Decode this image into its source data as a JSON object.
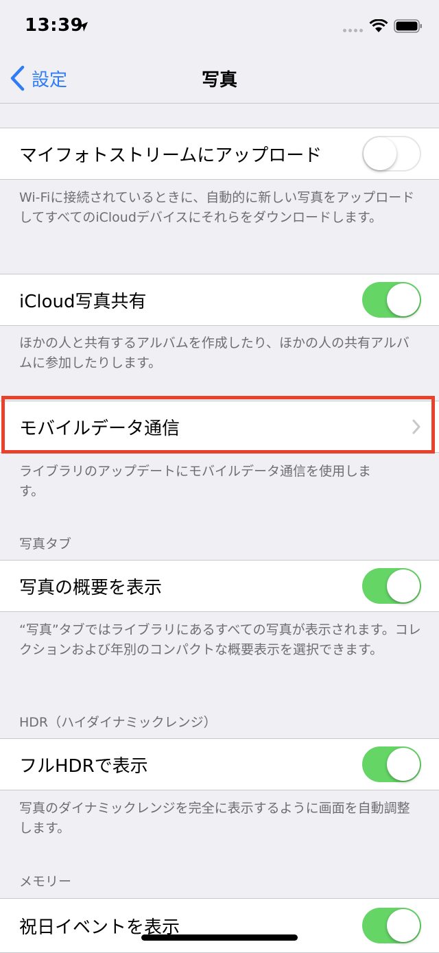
{
  "status_bar": {
    "time": "13:39"
  },
  "nav": {
    "back_label": "設定",
    "title": "写真"
  },
  "sections": {
    "my_photo_stream": {
      "label": "マイフォトストリームにアップロード",
      "enabled": false,
      "footer": "Wi-Fiに接続されているときに、自動的に新しい写真をアップロードしてすべてのiCloudデバイスにそれらをダウンロードします。"
    },
    "icloud_sharing": {
      "label": "iCloud写真共有",
      "enabled": true,
      "footer": "ほかの人と共有するアルバムを作成したり、ほかの人の共有アルバムに参加したりします。"
    },
    "cellular": {
      "label": "モバイルデータ通信",
      "footer": "ライブラリのアップデートにモバイルデータ通信を使用します。"
    },
    "photos_tab": {
      "header": "写真タブ",
      "label": "写真の概要を表示",
      "enabled": true,
      "footer": "“写真”タブではライブラリにあるすべての写真が表示されます。コレクションおよび年別のコンパクトな概要表示を選択できます。"
    },
    "hdr": {
      "header": "HDR（ハイダイナミックレンジ）",
      "label": "フルHDRで表示",
      "enabled": true,
      "footer": "写真のダイナミックレンジを完全に表示するように画面を自動調整します。"
    },
    "memories": {
      "header": "メモリー",
      "label": "祝日イベントを表示",
      "enabled": true
    }
  },
  "colors": {
    "accent": "#2f7cf6",
    "toggle_on": "#65d566",
    "highlight": "#e8412c",
    "background": "#efeff4"
  }
}
